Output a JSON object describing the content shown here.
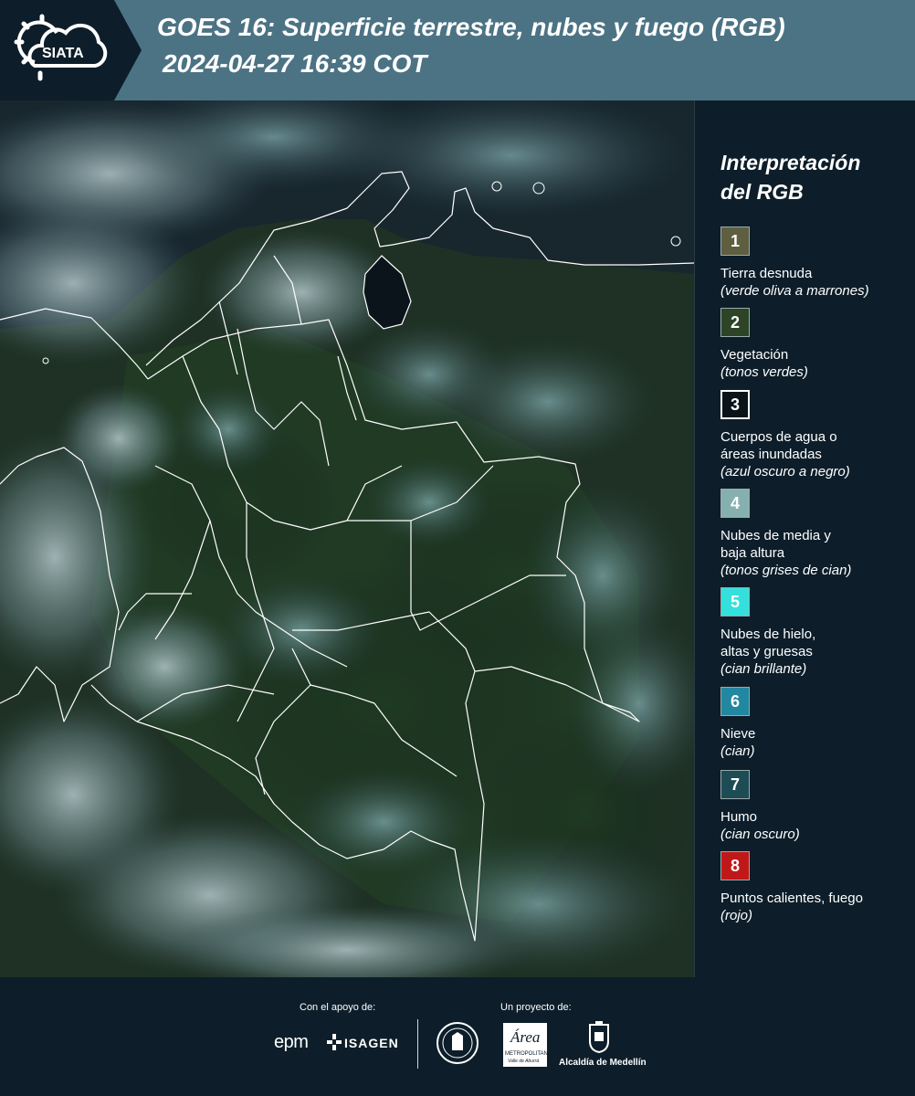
{
  "header": {
    "logo_text": "SIATA",
    "title_line1": "GOES 16: Superficie terrestre, nubes y fuego (RGB)",
    "title_line2": "2024-04-27 16:39 COT",
    "band_color": "#4c7384",
    "logo_color": "#ffffff"
  },
  "legend": {
    "title_line1": "Interpretación",
    "title_line2": "del RGB",
    "items": [
      {
        "num": "1",
        "label": "Tierra desnuda",
        "desc": "(verde oliva a marrones)",
        "color": "#5e5e40"
      },
      {
        "num": "2",
        "label": "Vegetación",
        "desc": "(tonos verdes)",
        "color": "#2d4426"
      },
      {
        "num": "3",
        "label": "Cuerpos de agua o áreas inundadas",
        "desc": "(azul oscuro a negro)",
        "color": "#0a1418"
      },
      {
        "num": "4",
        "label": "Nubes de media y baja altura",
        "desc": "(tonos grises de cian)",
        "color": "#86b0b0"
      },
      {
        "num": "5",
        "label": "Nubes de hielo, altas y gruesas",
        "desc": "(cian brillante)",
        "color": "#34e0dc"
      },
      {
        "num": "6",
        "label": "Nieve",
        "desc": "(cian)",
        "color": "#2287a0"
      },
      {
        "num": "7",
        "label": "Humo",
        "desc": "(cian oscuro)",
        "color": "#1d4c55"
      },
      {
        "num": "8",
        "label": "Puntos calientes, fuego",
        "desc": "(rojo)",
        "color": "#c01818"
      }
    ]
  },
  "footer": {
    "support_label": "Con el apoyo de:",
    "project_label": "Un proyecto de:",
    "epm": "epm",
    "isagen": "ISAGEN",
    "area_name": "Área",
    "area_sub1": "METROPOLITANA",
    "area_sub2": "Valle de Aburrá",
    "alcaldia": "Alcaldía de Medellín"
  }
}
